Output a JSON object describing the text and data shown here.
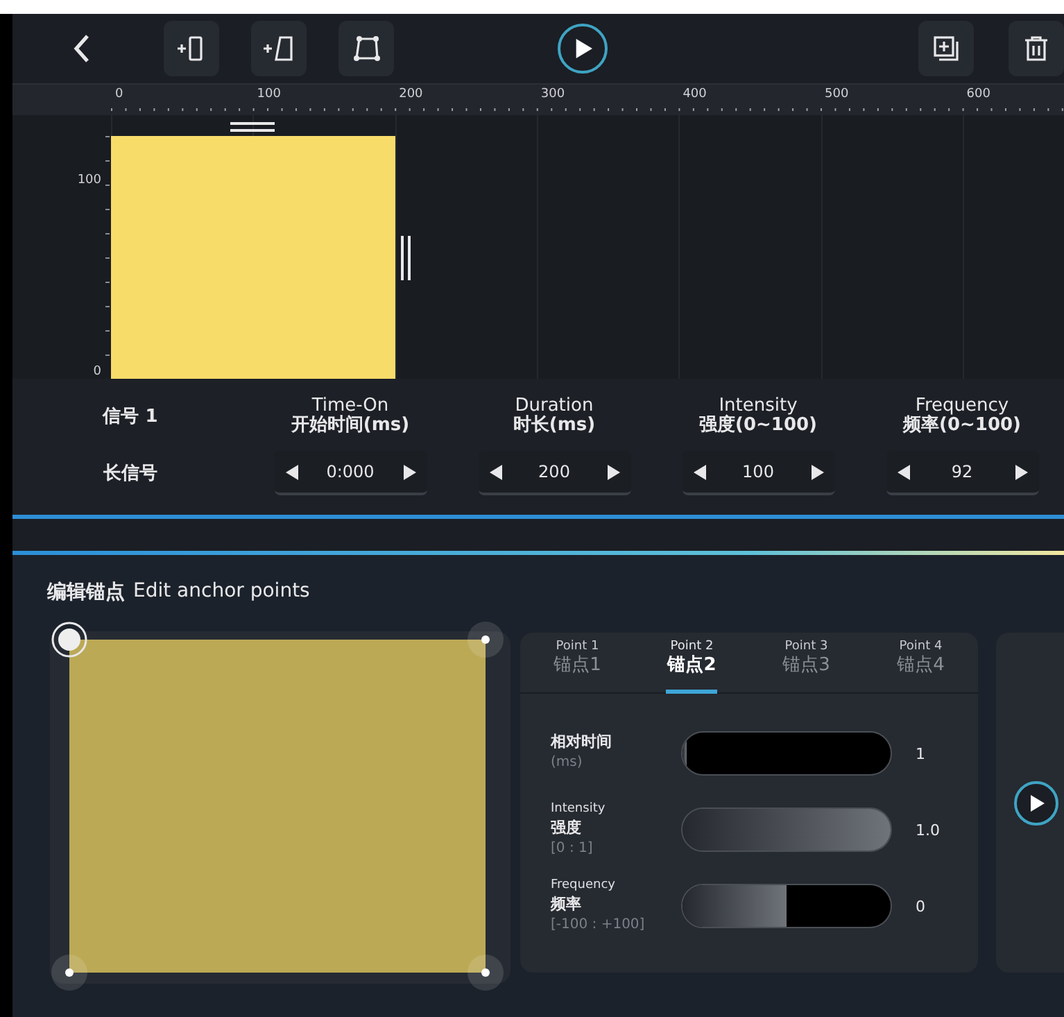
{
  "toolbar": {
    "left_buttons": [
      {
        "kind": "back"
      },
      {
        "kind": "add-bar"
      },
      {
        "kind": "add-ramp"
      },
      {
        "kind": "anchor-shape"
      }
    ],
    "playing": false,
    "right_buttons": [
      {
        "kind": "add-copy"
      },
      {
        "kind": "delete"
      }
    ]
  },
  "timeline": {
    "ruler_labels": [
      "0",
      "100",
      "200",
      "300",
      "400",
      "500",
      "600"
    ],
    "y_labels": [
      "100",
      "0"
    ]
  },
  "signal": {
    "name": "信号 1",
    "type": "长信号"
  },
  "params": [
    {
      "label_en": "Time-On",
      "label_zh": "开始时间(ms)",
      "value": "0:000"
    },
    {
      "label_en": "Duration",
      "label_zh": "时长(ms)",
      "value": "200"
    },
    {
      "label_en": "Intensity",
      "label_zh": "强度(0~100)",
      "value": "100"
    },
    {
      "label_en": "Frequency",
      "label_zh": "频率(0~100)",
      "value": "92"
    }
  ],
  "sheet": {
    "title_zh": "编辑锚点",
    "title_en": "Edit anchor points",
    "handles": [
      {
        "selected": true
      },
      {
        "selected": false
      },
      {
        "selected": false
      },
      {
        "selected": false
      }
    ],
    "tabs": [
      {
        "label_en": "Point 1",
        "label_zh": "锚点1",
        "selected": false
      },
      {
        "label_en": "Point 2",
        "label_zh": "锚点2",
        "selected": true
      },
      {
        "label_en": "Point 3",
        "label_zh": "锚点3",
        "selected": false
      },
      {
        "label_en": "Point 4",
        "label_zh": "锚点4",
        "selected": false
      }
    ],
    "sliders": [
      {
        "label_zh": "相对时间",
        "range": "(ms)",
        "level": 0,
        "reading": "1"
      },
      {
        "label_en": "Intensity",
        "label_zh": "强度",
        "range": "[0 : 1]",
        "level": 1,
        "reading": "1.0"
      },
      {
        "label_en": "Frequency",
        "label_zh": "频率",
        "range": "[-100 : +100]",
        "level": 0.5,
        "reading": "0"
      }
    ]
  }
}
